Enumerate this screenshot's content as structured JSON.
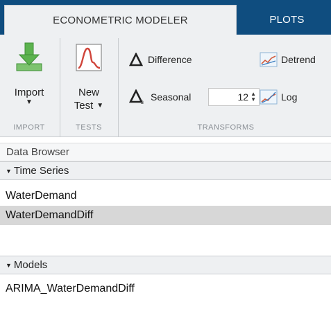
{
  "tabs": [
    {
      "label": "ECONOMETRIC MODELER",
      "active": true
    },
    {
      "label": "PLOTS",
      "active": false
    }
  ],
  "ribbon": {
    "import": {
      "label": "Import",
      "icon": "import-arrow-icon",
      "group": "IMPORT"
    },
    "new_test": {
      "label_line1": "New",
      "label_line2": "Test",
      "icon": "test-distribution-icon",
      "group": "TESTS"
    },
    "transforms": {
      "group": "TRANSFORMS",
      "difference": {
        "label": "Difference",
        "icon": "delta-icon"
      },
      "seasonal": {
        "label": "Seasonal",
        "icon": "delta-seasonal-icon",
        "value": "12"
      },
      "detrend": {
        "label": "Detrend",
        "icon": "detrend-chart-icon"
      },
      "log": {
        "label": "Log",
        "icon": "log-chart-icon"
      }
    }
  },
  "browser": {
    "title": "Data Browser",
    "time_series": {
      "header": "Time Series",
      "items": [
        {
          "name": "WaterDemand",
          "selected": false
        },
        {
          "name": "WaterDemandDiff",
          "selected": true
        }
      ]
    },
    "models": {
      "header": "Models",
      "items": [
        {
          "name": "ARIMA_WaterDemandDiff"
        }
      ]
    }
  },
  "colors": {
    "tab_strip": "#0f4d7f",
    "ribbon_bg": "#eef0f2",
    "selected_row": "#d7d7d7",
    "import_green": "#49a83f"
  }
}
